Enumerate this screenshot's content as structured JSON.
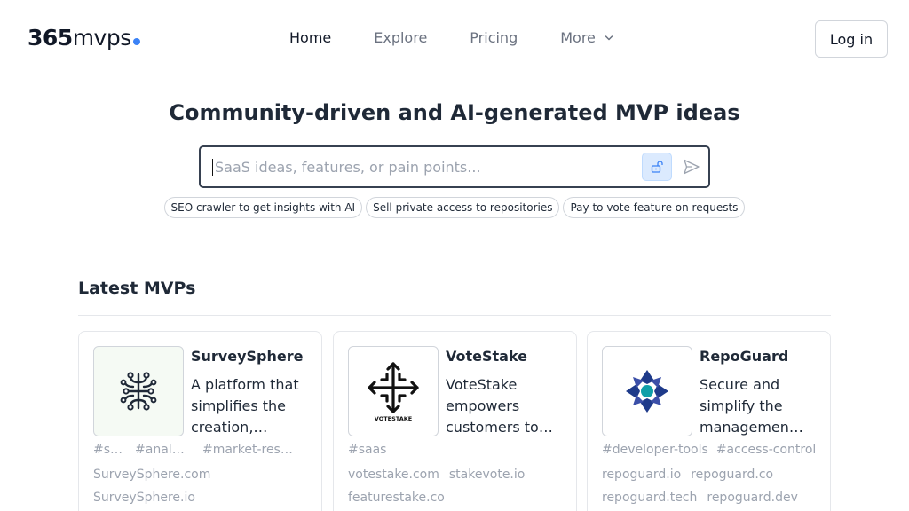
{
  "brand": {
    "logo_bold": "365",
    "logo_rest": "mvps",
    "accent": "#3b82f6"
  },
  "nav": {
    "links": [
      {
        "label": "Home",
        "active": true
      },
      {
        "label": "Explore",
        "active": false
      },
      {
        "label": "Pricing",
        "active": false
      }
    ],
    "more_label": "More",
    "login_label": "Log in"
  },
  "hero": {
    "title": "Community-driven and AI-generated MVP ideas",
    "search_placeholder": "SaaS ideas, features, or pain points...",
    "chips": [
      "SEO crawler to get insights with AI",
      "Sell private access to repositories",
      "Pay to vote feature on requests"
    ]
  },
  "latest": {
    "title": "Latest MVPs",
    "cards": [
      {
        "name": "SurveySphere",
        "description": "A platform that simplifies the creation,…",
        "icon": "neural-network-icon",
        "tags": [
          "#s…",
          "#analy…",
          "#market-rese…"
        ],
        "domains": [
          "SurveySphere.com",
          "SurveySphere.io"
        ]
      },
      {
        "name": "VoteStake",
        "description": "VoteStake empowers customers to…",
        "icon": "votestake-logo",
        "logo_caption": "VOTESTAKE",
        "tags": [
          "#saas"
        ],
        "domains": [
          "votestake.com",
          "stakevote.io",
          "featurestake.co"
        ]
      },
      {
        "name": "RepoGuard",
        "description": "Secure and simplify the managemen…",
        "icon": "repoguard-logo",
        "tags": [
          "#developer-tools",
          "#access-control"
        ],
        "domains": [
          "repoguard.io",
          "repoguard.co",
          "repoguard.tech",
          "repoguard.dev"
        ]
      }
    ]
  }
}
